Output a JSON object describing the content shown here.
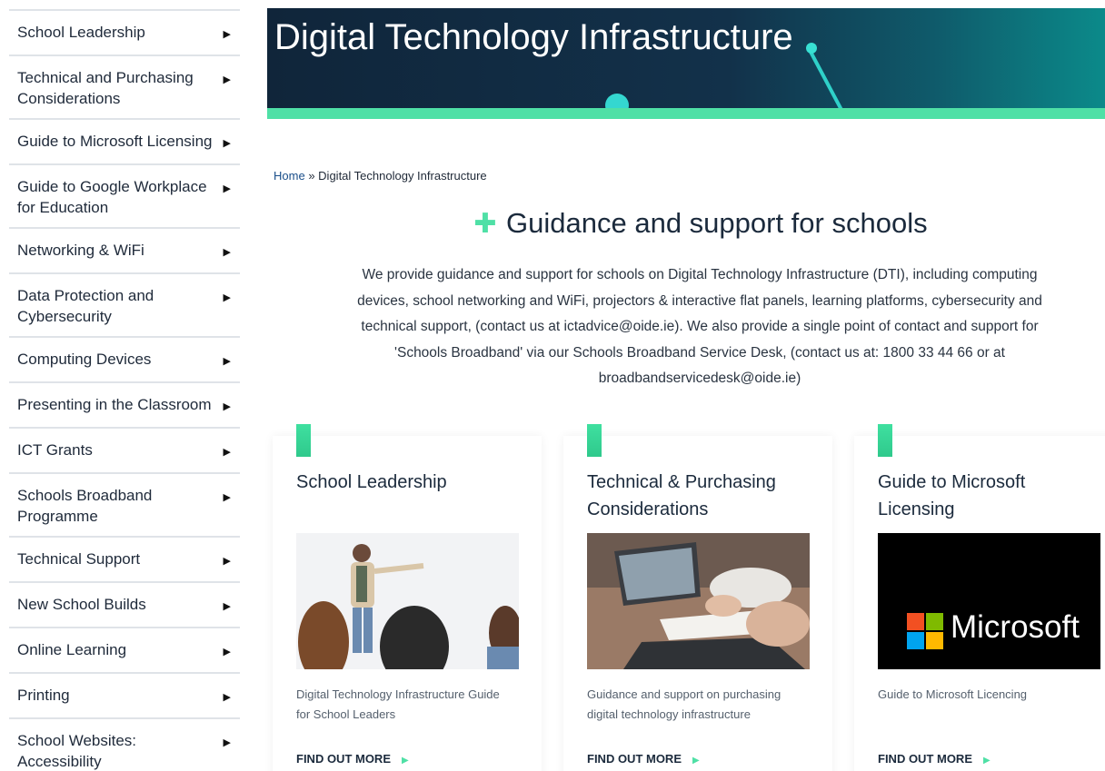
{
  "sidebar": {
    "items": [
      {
        "label": "School Leadership"
      },
      {
        "label": "Technical and Purchasing Considerations"
      },
      {
        "label": "Guide to Microsoft Licensing"
      },
      {
        "label": "Guide to Google Workplace for Education"
      },
      {
        "label": "Networking & WiFi"
      },
      {
        "label": "Data Protection and Cybersecurity"
      },
      {
        "label": "Computing Devices"
      },
      {
        "label": "Presenting in the Classroom"
      },
      {
        "label": "ICT Grants"
      },
      {
        "label": "Schools Broadband Programme"
      },
      {
        "label": "Technical Support"
      },
      {
        "label": "New School Builds"
      },
      {
        "label": "Online Learning"
      },
      {
        "label": "Printing"
      },
      {
        "label": "School Websites: Accessibility"
      }
    ]
  },
  "banner": {
    "title": "Digital Technology Infrastructure"
  },
  "breadcrumb": {
    "home": "Home",
    "separator": "»",
    "current": "Digital Technology Infrastructure"
  },
  "heading": {
    "icon": "plus-icon",
    "text": "Guidance and support for schools"
  },
  "intro": {
    "text": "We provide guidance and support for schools on Digital Technology Infrastructure (DTI), including computing devices, school networking and WiFi, projectors & interactive flat panels, learning platforms, cybersecurity and technical support, (contact us at ictadvice@oide.ie). We also provide a single point of contact and support for 'Schools Broadband' via our Schools Broadband Service Desk, (contact us at: 1800 33 44 66 or at broadbandservicedesk@oide.ie)"
  },
  "cards": [
    {
      "title": "School Leadership",
      "description": "Digital Technology Infrastructure Guide for School Leaders",
      "cta": "FIND OUT MORE"
    },
    {
      "title": "Technical & Purchasing Considerations",
      "description": "Guidance and support on purchasing digital technology infrastructure",
      "cta": "FIND OUT MORE"
    },
    {
      "title": "Guide to Microsoft Licensing",
      "description": "Guide to Microsoft Licencing",
      "cta": "FIND OUT MORE",
      "logo_text": "Microsoft"
    }
  ],
  "colors": {
    "accent": "#4fe0a6",
    "banner_dark": "#12314a",
    "link": "#1b4f8a"
  }
}
